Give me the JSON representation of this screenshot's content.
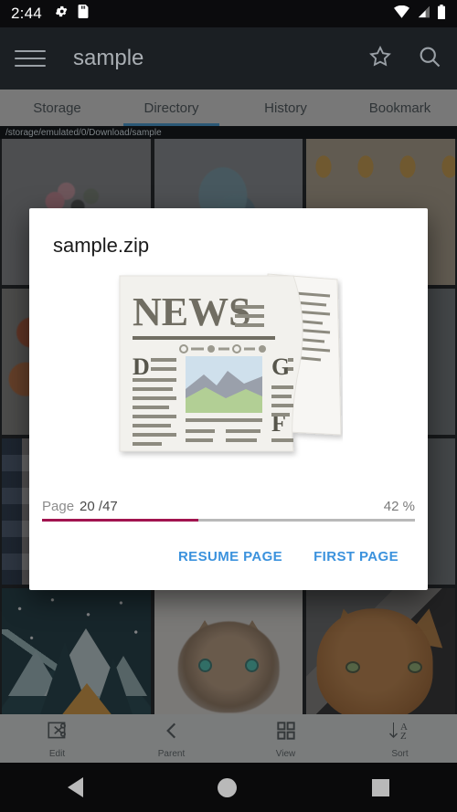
{
  "statusbar": {
    "time": "2:44",
    "icons": [
      "gear-icon",
      "sd-card-icon",
      "wifi-icon",
      "cell-signal-icon",
      "battery-icon"
    ]
  },
  "appbar": {
    "menu_icon": "hamburger-menu-icon",
    "title": "sample",
    "actions": [
      {
        "name": "star-icon",
        "label": "Favorite"
      },
      {
        "name": "search-icon",
        "label": "Search"
      }
    ]
  },
  "tabs": [
    {
      "label": "Storage",
      "active": false
    },
    {
      "label": "Directory",
      "active": true
    },
    {
      "label": "History",
      "active": false
    },
    {
      "label": "Bookmark",
      "active": false
    }
  ],
  "path": "/storage/emulated/0/Download/sample",
  "gallery": [
    {
      "name": "thumb-floral-pink",
      "style": "t-floral-pink"
    },
    {
      "name": "thumb-floral-blue",
      "style": "t-floral-blue"
    },
    {
      "name": "thumb-autumn-card",
      "style": "t-autumn"
    },
    {
      "name": "thumb-autumn-floral",
      "style": "t-autumn-floral"
    },
    {
      "name": "thumb-plain-gray-1",
      "style": "t-plain"
    },
    {
      "name": "thumb-plain-gray-2",
      "style": "t-plain"
    },
    {
      "name": "thumb-striped-pattern",
      "style": "t-stripes"
    },
    {
      "name": "thumb-plain-gray-3",
      "style": "t-plain"
    },
    {
      "name": "thumb-plain-gray-4",
      "style": "t-plain"
    },
    {
      "name": "thumb-camping-night",
      "style": "t-camp"
    },
    {
      "name": "thumb-cat-watercolor",
      "style": "t-cat-water"
    },
    {
      "name": "thumb-cat-photo",
      "style": "t-cat-photo"
    }
  ],
  "dialog": {
    "title": "sample.zip",
    "thumbnail_icon": "newspaper-icon",
    "thumbnail_masthead": "NEWS",
    "thumbnail_dropcaps": [
      "D",
      "G",
      "F"
    ],
    "page_label": "Page",
    "page_value": "20 /47",
    "percent_value": "42 %",
    "progress_percent": 42,
    "progress_color": "#a1144f",
    "buttons": [
      {
        "name": "resume-page-button",
        "label": "RESUME PAGE"
      },
      {
        "name": "first-page-button",
        "label": "FIRST PAGE"
      }
    ],
    "button_color": "#3b92dd"
  },
  "bottombar": [
    {
      "name": "edit",
      "label": "Edit",
      "icon": "scissors-crop-icon"
    },
    {
      "name": "parent",
      "label": "Parent",
      "icon": "chevron-left-icon"
    },
    {
      "name": "view",
      "label": "View",
      "icon": "grid-view-icon"
    },
    {
      "name": "sort",
      "label": "Sort",
      "icon": "sort-az-icon"
    }
  ],
  "navbar": [
    {
      "name": "back-button",
      "icon": "triangle-back-icon"
    },
    {
      "name": "home-button",
      "icon": "circle-home-icon"
    },
    {
      "name": "recents-button",
      "icon": "square-recents-icon"
    }
  ]
}
